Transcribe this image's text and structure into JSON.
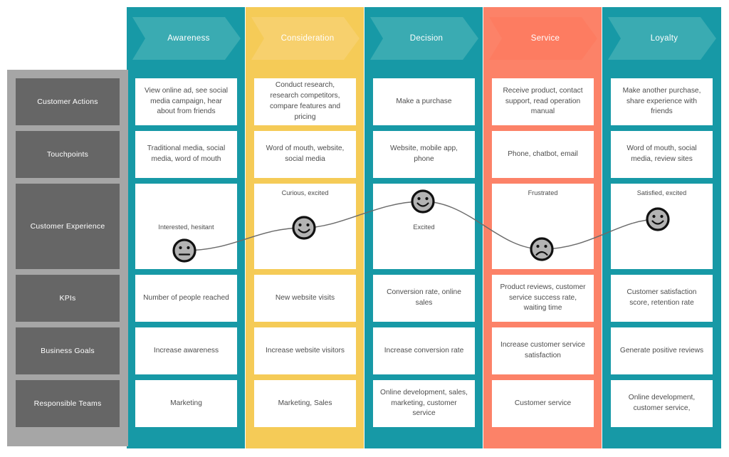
{
  "diagram": {
    "type": "customer-journey-map",
    "colors": {
      "teal": "#1799a6",
      "teal_header": "#3aabb2",
      "yellow": "#f5cb57",
      "yellow_header": "#f7d06d",
      "coral": "#fc8268",
      "coral_header": "#fd7c61",
      "rail_outer": "#a6a6a6",
      "rail_cell": "#666666",
      "card": "#ffffff",
      "text": "#4d4d4d",
      "curve": "#6b6b6b"
    }
  },
  "stages": [
    {
      "id": "awareness",
      "label": "Awareness",
      "color": "teal"
    },
    {
      "id": "consideration",
      "label": "Consideration",
      "color": "yellow"
    },
    {
      "id": "decision",
      "label": "Decision",
      "color": "teal"
    },
    {
      "id": "service",
      "label": "Service",
      "color": "coral"
    },
    {
      "id": "loyalty",
      "label": "Loyalty",
      "color": "teal"
    }
  ],
  "rows": [
    {
      "id": "customer-actions",
      "label": "Customer Actions"
    },
    {
      "id": "touchpoints",
      "label": "Touchpoints"
    },
    {
      "id": "customer-experience",
      "label": "Customer Experience"
    },
    {
      "id": "kpis",
      "label": "KPIs"
    },
    {
      "id": "business-goals",
      "label": "Business Goals"
    },
    {
      "id": "responsible-teams",
      "label": "Responsible Teams"
    }
  ],
  "cells": {
    "customer_actions": [
      "View online ad, see social media campaign, hear about from friends",
      "Conduct research, research competitors, compare features and pricing",
      "Make a purchase",
      "Receive product, contact support, read operation manual",
      "Make another purchase, share experience with friends"
    ],
    "touchpoints": [
      "Traditional media, social media, word of mouth",
      "Word of mouth, website, social media",
      "Website, mobile app, phone",
      "Phone, chatbot, email",
      "Word of mouth, social media, review sites"
    ],
    "customer_experience": [
      "Interested, hesitant",
      "Curious, excited",
      "Excited",
      "Frustrated",
      "Satisfied, excited"
    ],
    "kpis": [
      "Number of people reached",
      "New website visits",
      "Conversion rate, online sales",
      "Product reviews, customer service success rate, waiting time",
      "Customer satisfaction score, retention rate"
    ],
    "business_goals": [
      "Increase awareness",
      "Increase website visitors",
      "Increase conversion rate",
      "Increase customer service satisfaction",
      "Generate positive reviews"
    ],
    "responsible_teams": [
      "Marketing",
      "Marketing, Sales",
      "Online development, sales, marketing, customer service",
      "Customer service",
      "Online development, customer service,"
    ]
  },
  "emotion_curve": {
    "faces": [
      {
        "stage": "awareness",
        "mood": "neutral-face-icon",
        "caption": "Interested, hesitant"
      },
      {
        "stage": "consideration",
        "mood": "happy-face-icon",
        "caption": "Curious, excited"
      },
      {
        "stage": "decision",
        "mood": "happy-face-icon",
        "caption": "Excited"
      },
      {
        "stage": "service",
        "mood": "sad-face-icon",
        "caption": "Frustrated"
      },
      {
        "stage": "loyalty",
        "mood": "happy-face-icon",
        "caption": "Satisfied, excited"
      }
    ]
  }
}
